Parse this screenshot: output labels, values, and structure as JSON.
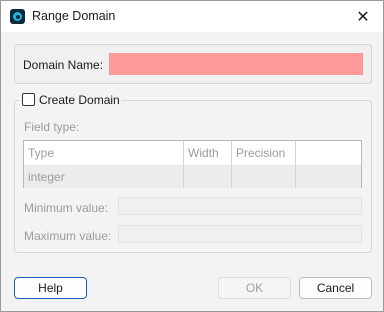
{
  "window": {
    "title": "Range Domain",
    "close_glyph": "✕",
    "icon": "app-icon"
  },
  "domain_name": {
    "label": "Domain Name:",
    "value": "",
    "highlight_color": "#ff9a9a"
  },
  "create_domain": {
    "label": "Create Domain",
    "checked": false
  },
  "field_type": {
    "label": "Field type:",
    "columns": [
      "Type",
      "Width",
      "Precision",
      ""
    ],
    "rows": [
      [
        "integer",
        "",
        "",
        ""
      ]
    ]
  },
  "minimum": {
    "label": "Minimum value:",
    "value": ""
  },
  "maximum": {
    "label": "Maximum value:",
    "value": ""
  },
  "buttons": {
    "help": "Help",
    "ok": "OK",
    "cancel": "Cancel"
  },
  "colors": {
    "focus_border": "#1a5fb4",
    "disabled_text": "#9b9b9b"
  }
}
